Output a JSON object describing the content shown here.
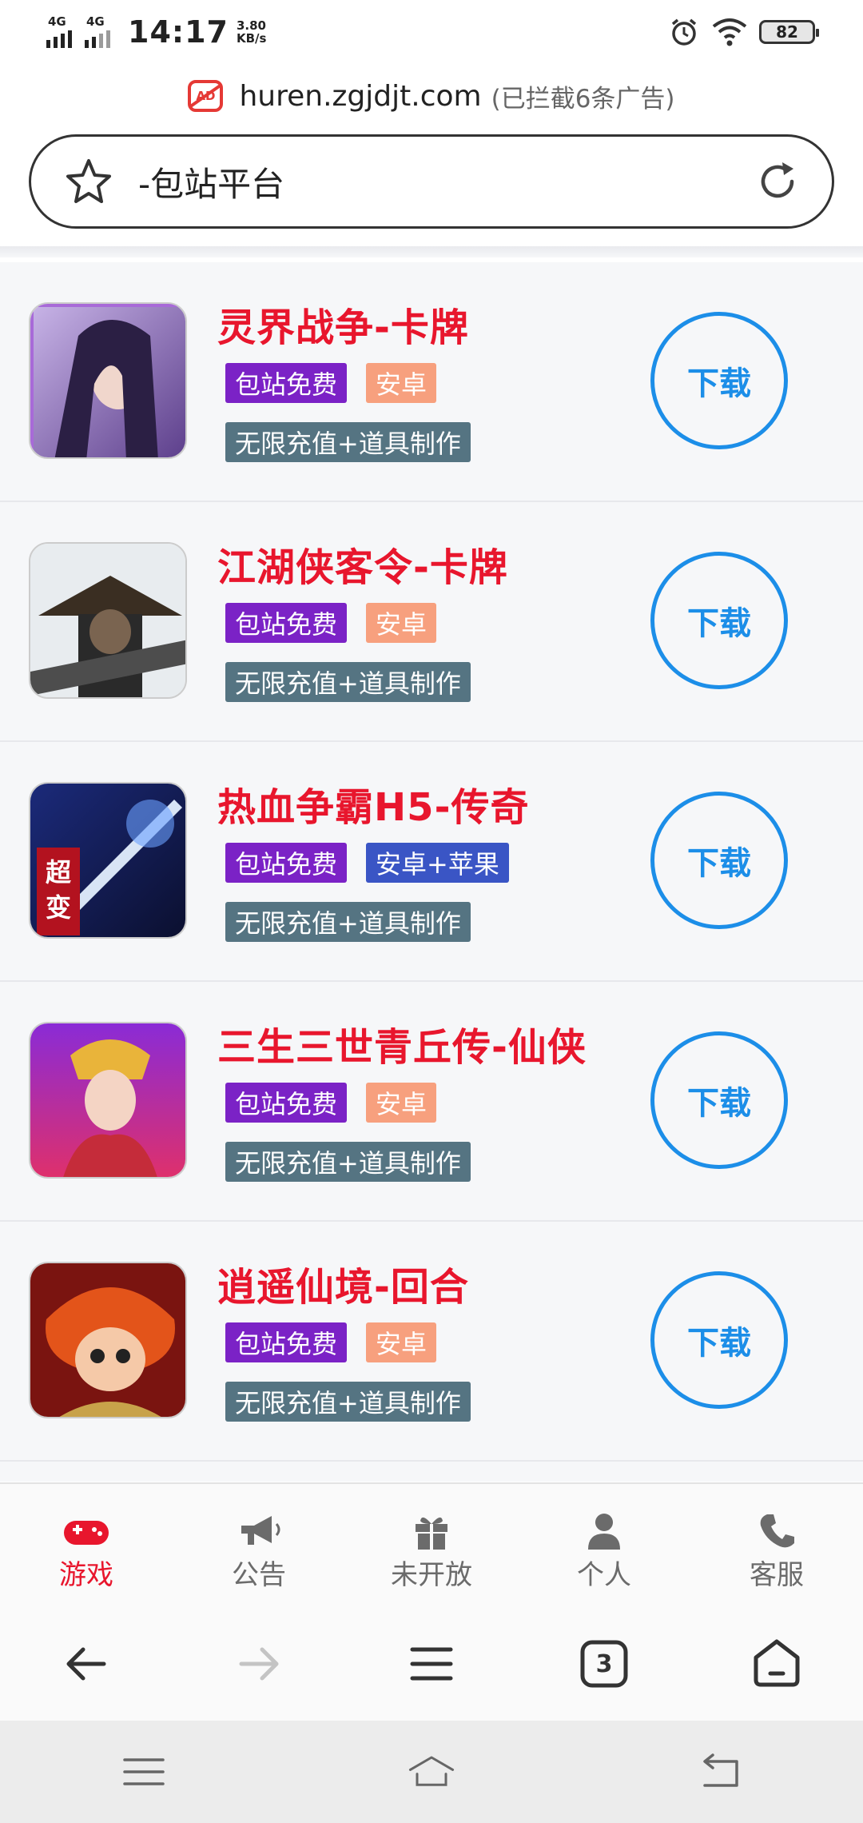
{
  "status_bar": {
    "net1": "4G",
    "net2": "4G",
    "time": "14:17",
    "speed_value": "3.80",
    "speed_unit": "KB/s",
    "battery": "82"
  },
  "browser": {
    "ad_icon": "AD",
    "domain": "huren.zgjdjt.com",
    "blocked_note": "(已拦截6条广告)",
    "page_title": "-包站平台"
  },
  "games": [
    {
      "title": "灵界战争-卡牌",
      "tag1": "包站免费",
      "tag2": "安卓",
      "tag2_style": "orange",
      "feature": "无限充值+道具制作",
      "button": "下载"
    },
    {
      "title": "江湖侠客令-卡牌",
      "tag1": "包站免费",
      "tag2": "安卓",
      "tag2_style": "orange",
      "feature": "无限充值+道具制作",
      "button": "下载"
    },
    {
      "title": "热血争霸H5-传奇",
      "tag1": "包站免费",
      "tag2": "安卓+苹果",
      "tag2_style": "blue",
      "feature": "无限充值+道具制作",
      "button": "下载",
      "thumb_text": "超变"
    },
    {
      "title": "三生三世青丘传-仙侠",
      "tag1": "包站免费",
      "tag2": "安卓",
      "tag2_style": "orange",
      "feature": "无限充值+道具制作",
      "button": "下载"
    },
    {
      "title": "逍遥仙境-回合",
      "tag1": "包站免费",
      "tag2": "安卓",
      "tag2_style": "orange",
      "feature": "无限充值+道具制作",
      "button": "下载"
    }
  ],
  "tabs": [
    {
      "label": "游戏",
      "icon": "gamepad-icon",
      "active": true
    },
    {
      "label": "公告",
      "icon": "megaphone-icon",
      "active": false
    },
    {
      "label": "未开放",
      "icon": "gift-icon",
      "active": false
    },
    {
      "label": "个人",
      "icon": "user-icon",
      "active": false
    },
    {
      "label": "客服",
      "icon": "phone-icon",
      "active": false
    }
  ],
  "toolbar": {
    "tab_count": "3"
  },
  "colors": {
    "accent_red": "#e8162d",
    "download_blue": "#1c8ee8",
    "tag_purple": "#7b22c6",
    "tag_orange": "#f7a07e",
    "tag_blue": "#3a55c5",
    "feature_gray": "#557482"
  }
}
